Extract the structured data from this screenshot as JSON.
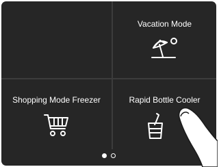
{
  "tiles": {
    "vacation": {
      "label": "Vacation Mode",
      "icon": "beach-umbrella-sun-icon"
    },
    "shopping": {
      "label": "Shopping Mode Freezer",
      "icon": "shopping-cart-icon"
    },
    "bottle": {
      "label": "Rapid Bottle Cooler",
      "icon": "bottle-in-glass-icon"
    }
  },
  "pager": {
    "pages": 2,
    "current": 1
  },
  "colors": {
    "screen_bg": "#262626",
    "divider": "#3c3c3c",
    "text": "#ffffff"
  },
  "touch_hint": {
    "icon": "pointing-finger-icon",
    "target": "bottle"
  }
}
